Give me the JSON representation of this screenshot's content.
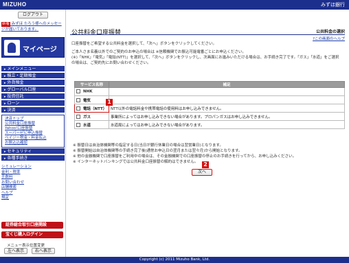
{
  "header": {
    "logo": "MIZUHO",
    "bank": "みずほ銀行"
  },
  "sidebar": {
    "logout": "ログアウト",
    "new_badge": "新着",
    "new_message": "みずほ たろう様へのメッセージが届いております。",
    "mypage": "マイページ",
    "menus": [
      "メインメニュー",
      "積立・定期預金",
      "外貨預金",
      "グローバル口座",
      "投資信託",
      "ローン",
      "決済"
    ],
    "sub_links": [
      "決済トップ",
      "公共料金口座振替",
      "Yahoo!口座振替",
      "スーパーゼビ申込振替",
      "ペイジー税金・料金払込",
      "お振込込確認"
    ],
    "menus2": [
      "セキュリティ",
      "各種手続き"
    ],
    "links": [
      "シミュレーション",
      "金利・税率",
      "手数料",
      "お問い合わせ",
      "店舗検索",
      "ヘルプ",
      "規定"
    ],
    "securities_button": "証券総合取引口座開設",
    "lottery_button": "宝くじ購入ログイン",
    "menu_position_label": "メニュー表示位置変更",
    "left_button": "左へ表示",
    "right_button": "右へ表示"
  },
  "main": {
    "title": "公共料金口座振替",
    "section": "公共料金の選択",
    "help": "この画面のヘルプ",
    "intro": [
      "口座振替をご希望する公共料金を選択して、「次へ」ボタンをクリックしてください。",
      "ご本人さま名義以外でのご契約のお申込の場合は ※信頼機関でお振込可能電番ごとにお申込ください。",
      "(※)「NHK」「電気」「電話(NTT)」を選択して、「次へ」ボタンをクリックし、次画面にお進みいただける場合は、お手続き完了です。「ガス」「水道」をご選択の場合は、ご契約先にお問い合わせください。"
    ],
    "table": {
      "headers": [
        "サービス名称",
        "補足"
      ],
      "rows": [
        {
          "name": "NHK",
          "note": ""
        },
        {
          "name": "電気",
          "note": ""
        },
        {
          "name": "電話（NTT）",
          "note": "NTT以外の電話料金や携帯電話の使用料はお申し込みできません。"
        },
        {
          "name": "ガス",
          "note": "事業所によってはお申し込みできない場合があります。プロパンガスはお申し込みできません。"
        },
        {
          "name": "水道",
          "note": "水道局によってはお申し込みできない場合があります。"
        }
      ]
    },
    "notes": [
      "※ 振替日は自治体機関等の指定する日(当日が銀行休業日の場合は翌営業日)となります。",
      "※ 振替開始は自治体機関等の手続き完了後(通常お申込日の翌月または翌々月)から開始となります。",
      "※ 他の金融機関で口座振替をご利用中の場合は、その金融機関での口座振替の停止のお手続きを行ってから、お申し込みください。",
      "※ インターネットバンキングでは公共料金口座振替の解約はできません。"
    ],
    "next": "次へ",
    "marker1": "1",
    "marker2": "2"
  },
  "footer": "Copyright (c) 2011 Mizuho Bank, Ltd."
}
